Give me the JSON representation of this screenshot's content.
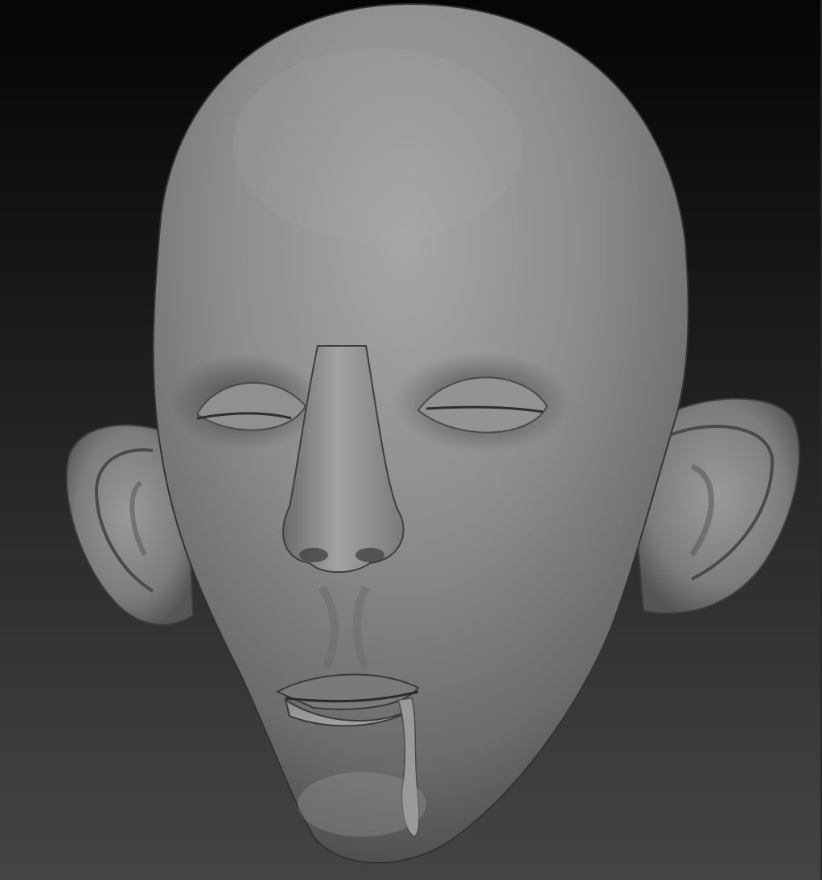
{
  "viewport": {
    "subject": "sculpted-head-model",
    "background_top": "#050505",
    "background_bottom": "#444444",
    "material_color": "#8f8f8f"
  }
}
